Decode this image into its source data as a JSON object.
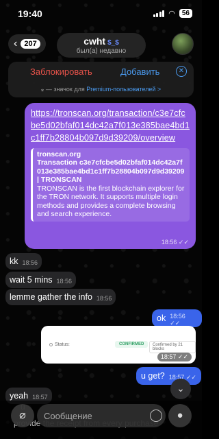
{
  "status_bar": {
    "time": "19:40",
    "battery": "56"
  },
  "header": {
    "back_count": "207",
    "title": "cwht",
    "title_emoji": "$_$",
    "subtitle": "был(а) недавно"
  },
  "action_bar": {
    "block_label": "Заблокировать",
    "add_label": "Добавить",
    "premium_prefix": "— значок для",
    "premium_link": "Premium-пользователей",
    "premium_chevron": ">"
  },
  "messages": [
    {
      "type": "link",
      "url": "https://tronscan.org/transaction/c3e7cfcbe5d02bfaf014dc42a7f013e385bae4bd1c1ff7b28804b097d9d39209/overview",
      "preview_site": "tronscan.org",
      "preview_title": "Transaction c3e7cfcbe5d02bfaf014dc42a7f013e385bae4bd1c1ff7b28804b097d9d39209 | TRONSCAN",
      "preview_desc": "TRONSCAN is the first blockchain explorer for the TRON network. It supports multiple login methods and provides a complete browsing and search experience.",
      "time": "18:56",
      "check": "✓✓"
    },
    {
      "type": "in",
      "text": "kk",
      "time": "18:56"
    },
    {
      "type": "in",
      "text": "wait 5 mins",
      "time": "18:56"
    },
    {
      "type": "in",
      "text": "lemme gather the info",
      "time": "18:56"
    },
    {
      "type": "out",
      "text": "ok",
      "time": "18:56",
      "check": "✓✓"
    },
    {
      "type": "photo",
      "status_label": "Status:",
      "badge": "CONFIRMED",
      "confirmed_text": "Confirmed by 21 blocks",
      "time": "18:57",
      "check": "✓✓"
    },
    {
      "type": "out",
      "text": "u get?",
      "time": "18:57",
      "check": "✓✓"
    },
    {
      "type": "in",
      "text": "yeah",
      "time": "18:57"
    }
  ],
  "input": {
    "placeholder": "Сообщение",
    "ghost_top": "u",
    "ghost_bottom": "provide the receipt from every purchase"
  },
  "colors": {
    "outgoing": "#3a64ea",
    "link_bubble": "#8a57e0",
    "incoming": "#262628",
    "block": "#e8534a",
    "accent": "#4b9bf0"
  }
}
